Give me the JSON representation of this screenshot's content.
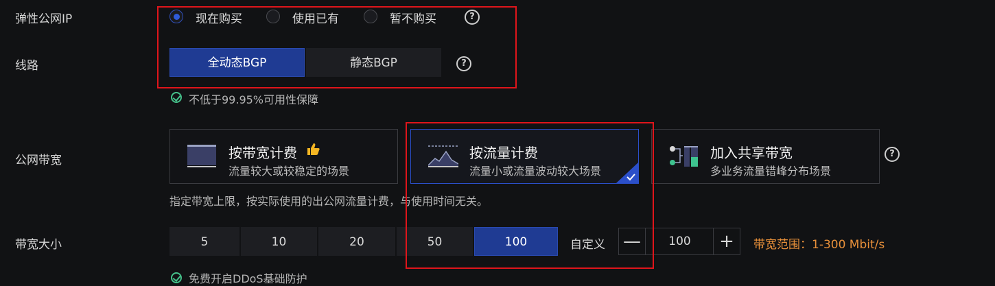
{
  "eip": {
    "label": "弹性公网IP",
    "options": [
      "现在购买",
      "使用已有",
      "暂不购买"
    ],
    "selected": "现在购买"
  },
  "line": {
    "label": "线路",
    "options": [
      "全动态BGP",
      "静态BGP"
    ],
    "selected": "全动态BGP",
    "note": "不低于99.95%可用性保障"
  },
  "bandwidth": {
    "label": "公网带宽",
    "cards": [
      {
        "title": "按带宽计费",
        "sub": "流量较大或较稳定的场景",
        "badge": "thumbs-up-icon"
      },
      {
        "title": "按流量计费",
        "sub": "流量小或流量波动较大场景",
        "selected": true
      },
      {
        "title": "加入共享带宽",
        "sub": "多业务流量错峰分布场景"
      }
    ],
    "desc": "指定带宽上限，按实际使用的出公网流量计费，与使用时间无关。"
  },
  "size": {
    "label": "带宽大小",
    "options": [
      "5",
      "10",
      "20",
      "50",
      "100"
    ],
    "selected": "100",
    "custom_label": "自定义",
    "minus": "—",
    "plus": "+",
    "value": "100",
    "range": "带宽范围：1-300 Mbit/s"
  },
  "ddos_note": "免费开启DDoS基础防护",
  "colors": {
    "accent": "#1f3b93",
    "range": "#e8903a",
    "ok": "#45c08a",
    "highlight": "#e0151b"
  }
}
